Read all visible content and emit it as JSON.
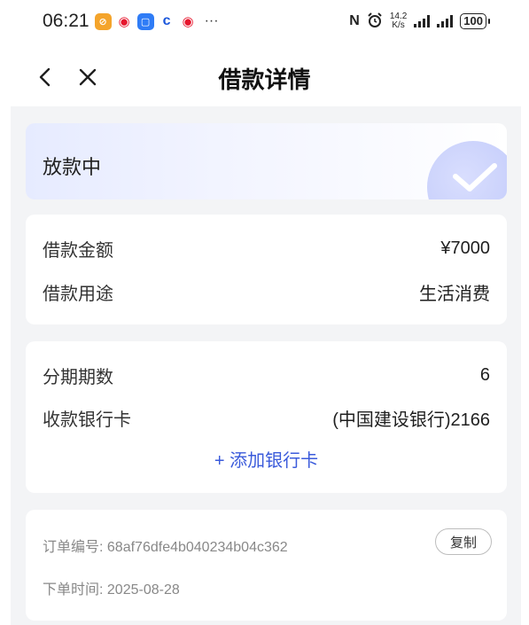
{
  "status_bar": {
    "time": "06:21",
    "dots": "···",
    "nfc": "N",
    "speed_value": "14.2",
    "speed_unit": "K/s",
    "battery": "100"
  },
  "nav": {
    "title": "借款详情"
  },
  "loan_status": {
    "text": "放款中"
  },
  "loan_info": {
    "amount_label": "借款金额",
    "amount_value": "¥7000",
    "purpose_label": "借款用途",
    "purpose_value": "生活消费"
  },
  "installment_info": {
    "periods_label": "分期期数",
    "periods_value": "6",
    "bank_card_label": "收款银行卡",
    "bank_card_value": "(中国建设银行)2166",
    "add_card_label": "+ 添加银行卡"
  },
  "order_info": {
    "order_no_label": "订单编号:",
    "order_no_value": "68af76dfe4b040234b04c362",
    "copy_label": "复制",
    "order_time_label": "下单时间:",
    "order_time_value": "2025-08-28"
  },
  "colors": {
    "accent": "#3b5bdb",
    "page_bg": "#f3f4f6"
  }
}
